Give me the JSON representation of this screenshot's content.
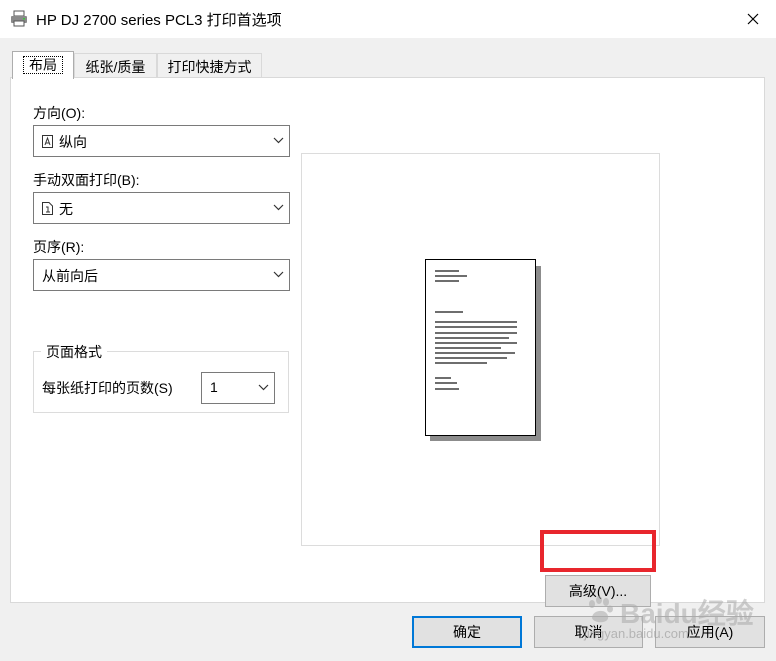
{
  "window": {
    "title": "HP DJ 2700 series PCL3 打印首选项"
  },
  "tabs": [
    {
      "label": "布局",
      "active": true
    },
    {
      "label": "纸张/质量",
      "active": false
    },
    {
      "label": "打印快捷方式",
      "active": false
    }
  ],
  "layout_tab": {
    "orientation": {
      "label": "方向(O):",
      "value": "纵向",
      "icon": "portrait-page-icon"
    },
    "duplex": {
      "label": "手动双面打印(B):",
      "value": "无",
      "icon": "single-page-icon"
    },
    "page_order": {
      "label": "页序(R):",
      "value": "从前向后"
    },
    "page_format": {
      "group_title": "页面格式",
      "pages_per_sheet_label": "每张纸打印的页数(S)",
      "pages_per_sheet_value": "1"
    },
    "advanced_button": "高级(V)..."
  },
  "footer": {
    "ok": "确定",
    "cancel": "取消",
    "apply": "应用(A)"
  },
  "watermark": {
    "brand": "Baidu经验",
    "url": "jingyan.baidu.com"
  },
  "colors": {
    "highlight": "#e8262d",
    "focus_border": "#0078d7"
  }
}
